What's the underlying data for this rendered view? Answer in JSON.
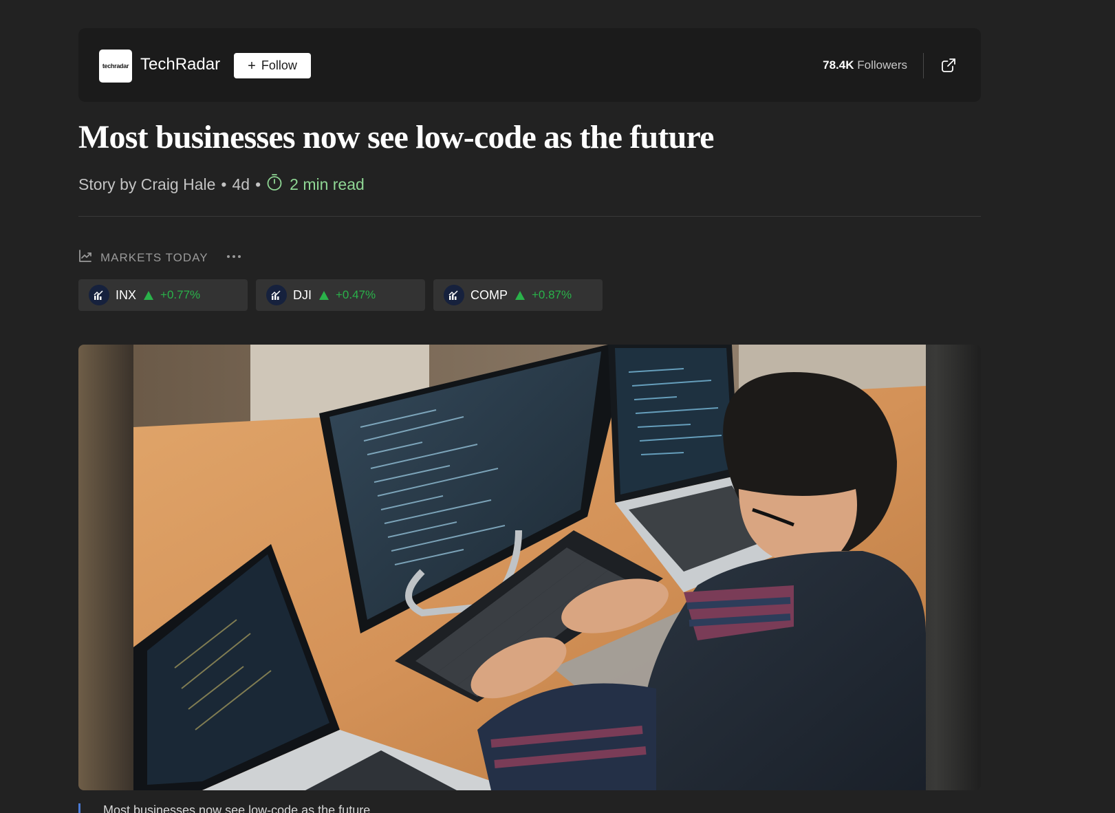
{
  "publisher": {
    "logo_text": "techradar",
    "name": "TechRadar",
    "follow_label": "Follow",
    "followers_count": "78.4K",
    "followers_label": "Followers"
  },
  "article": {
    "headline": "Most businesses now see low-code as the future",
    "byline": "Story by Craig Hale",
    "age": "4d",
    "separator": "•",
    "read_time": "2 min read"
  },
  "markets": {
    "header": "MARKETS TODAY",
    "tickers": [
      {
        "symbol": "INX",
        "change": "+0.77%",
        "direction": "up"
      },
      {
        "symbol": "DJI",
        "change": "+0.47%",
        "direction": "up"
      },
      {
        "symbol": "COMP",
        "change": "+0.87%",
        "direction": "up"
      }
    ]
  },
  "hero": {
    "caption": "Most businesses now see low-code as the future"
  },
  "colors": {
    "background": "#222222",
    "accent_green": "#2ab24a",
    "read_time_green": "#8fd694",
    "caption_accent": "#4b7bd6"
  },
  "icons": {
    "followers_action": "open-external-icon",
    "read_time": "timer-icon",
    "markets": "chart-line-icon",
    "markets_more": "more-horizontal-icon",
    "ticker": "market-chart-icon"
  }
}
